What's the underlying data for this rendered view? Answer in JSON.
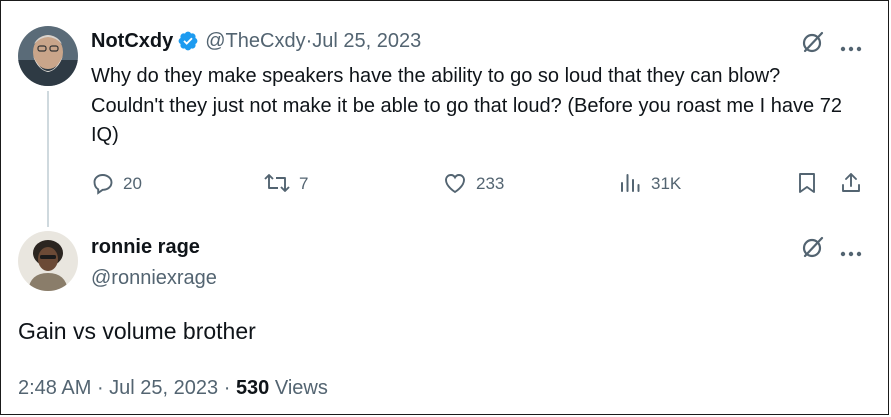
{
  "tweet": {
    "display_name": "NotCxdy",
    "handle": "@TheCxdy",
    "separator": " · ",
    "date": "Jul 25, 2023",
    "text": "Why do they make speakers have the ability to go so loud that they can blow? Couldn't they just not make it be able to go that loud? (Before you roast me I have 72 IQ)",
    "stats": {
      "replies": "20",
      "retweets": "7",
      "likes": "233",
      "views": "31K"
    }
  },
  "reply": {
    "display_name": "ronnie rage",
    "handle": "@ronniexrage",
    "text": "Gain vs volume brother",
    "time": "2:48 AM",
    "separator": " · ",
    "date": "Jul 25, 2023",
    "separator2": " · ",
    "views_count": "530",
    "views_label": " Views"
  },
  "colors": {
    "text_primary": "#0f1419",
    "text_secondary": "#536471",
    "verified_blue": "#1d9bf0",
    "thread_line": "#cfd9de"
  },
  "icons": [
    "verified-badge-icon",
    "grok-icon",
    "more-icon",
    "reply-icon",
    "retweet-icon",
    "like-icon",
    "views-icon",
    "bookmark-icon",
    "share-icon"
  ]
}
